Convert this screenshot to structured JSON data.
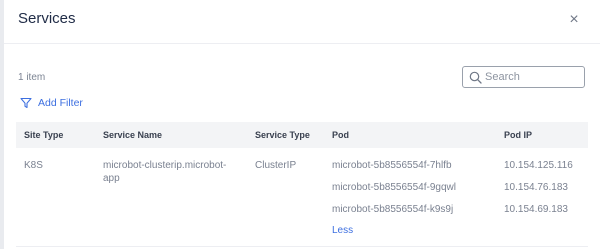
{
  "modal": {
    "title": "Services",
    "close_glyph": "×"
  },
  "toolbar": {
    "item_count": "1 item",
    "search_placeholder": "Search",
    "add_filter_label": "Add Filter"
  },
  "table": {
    "columns": [
      "Site Type",
      "Service Name",
      "Service Type",
      "Pod",
      "Pod IP"
    ],
    "row": {
      "site_type": "K8S",
      "service_name_line1": "microbot-clusterip.microbot-",
      "service_name_line2": "app",
      "service_type": "ClusterIP",
      "pods": [
        "microbot-5b8556554f-7hlfb",
        "microbot-5b8556554f-9gqwl",
        "microbot-5b8556554f-k9s9j"
      ],
      "pod_ips": [
        "10.154.125.116",
        "10.154.76.183",
        "10.154.69.183"
      ],
      "toggle_label": "Less"
    }
  },
  "icons": {
    "close": "close-icon",
    "search": "search-icon",
    "filter": "filter-icon"
  },
  "colors": {
    "accent": "#3d6fe0",
    "header_bg": "#f3f4f6"
  }
}
